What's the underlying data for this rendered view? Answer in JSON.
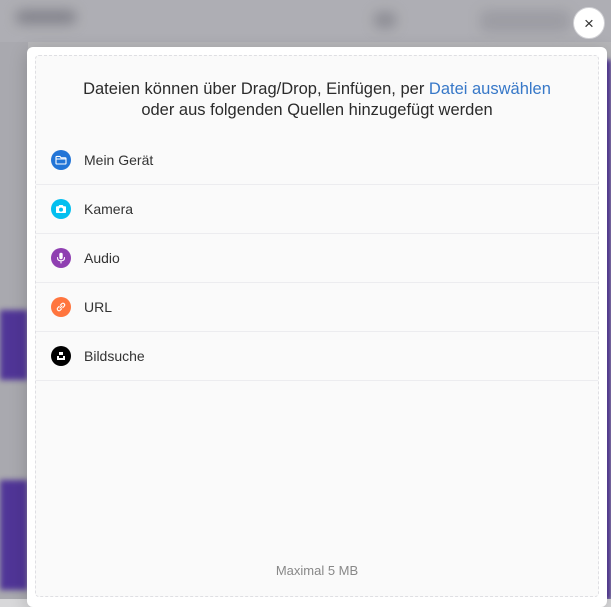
{
  "dialog": {
    "title_pre": "Dateien können über Drag/Drop, Einfügen, per ",
    "title_link": "Datei auswählen",
    "title_post": "oder aus folgenden Quellen hinzugefügt werden",
    "close_label": "×",
    "footer": "Maximal 5 MB"
  },
  "sources": [
    {
      "label": "Mein Gerät",
      "icon": "folder-icon",
      "color": "#2275d7"
    },
    {
      "label": "Kamera",
      "icon": "camera-icon",
      "color": "#03bfef"
    },
    {
      "label": "Audio",
      "icon": "microphone-icon",
      "color": "#8f3fb1"
    },
    {
      "label": "URL",
      "icon": "link-icon",
      "color": "#ff753e"
    },
    {
      "label": "Bildsuche",
      "icon": "unsplash-icon",
      "color": "#000000"
    }
  ]
}
